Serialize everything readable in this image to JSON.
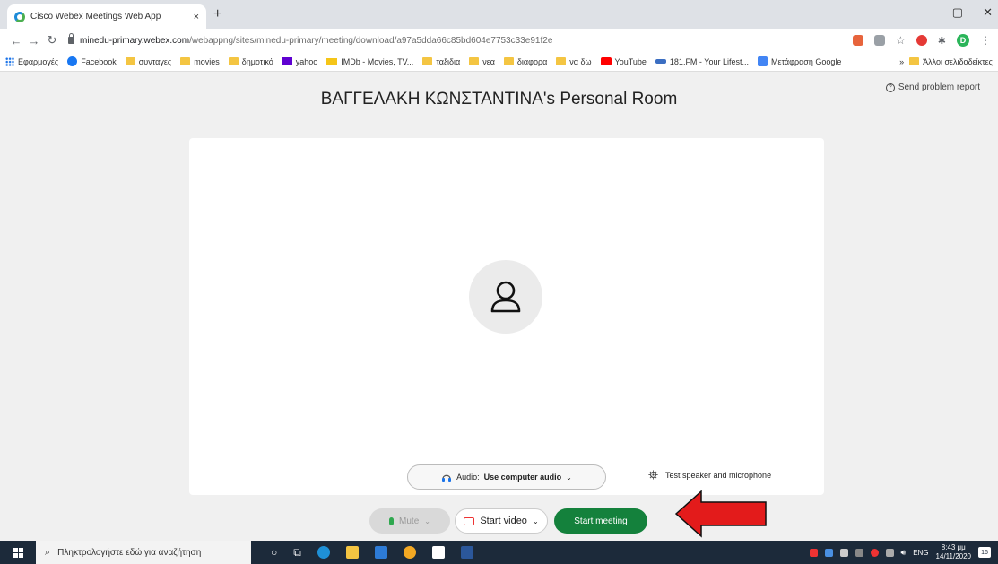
{
  "browser": {
    "tab_title": "Cisco Webex Meetings Web App",
    "tab_close": "×",
    "new_tab": "+",
    "url_host": "minedu-primary.webex.com",
    "url_path": "/webappng/sites/minedu-primary/meeting/download/a97a5dda66c85bd604e7753c33e91f2e",
    "profile_initial": "D",
    "window_controls": [
      "–",
      "▢",
      "✕"
    ]
  },
  "bookmarks": {
    "items": [
      "Εφαρμογές",
      "Facebook",
      "συνταγες",
      "movies",
      "δημοτικό",
      "yahoo",
      "IMDb - Movies, TV...",
      "ταξιδια",
      "νεα",
      "διαφορα",
      "να δω",
      "YouTube",
      "181.FM - Your Lifest...",
      "Μετάφραση Google"
    ],
    "overflow": "»",
    "other_bookmarks": "Άλλοι σελιδοδείκτες"
  },
  "page": {
    "room_title": "ΒΑΓΓΕΛΑΚΗ ΚΩΝΣΤΑΝΤΙΝΑ's Personal Room",
    "report_link": "Send problem report",
    "audio_prefix": "Audio:",
    "audio_value": "Use computer audio",
    "test_speaker": "Test speaker and microphone"
  },
  "controls": {
    "mute": "Mute",
    "start_video": "Start video",
    "start_meeting": "Start meeting",
    "chevron": "⌄"
  },
  "taskbar": {
    "search_placeholder": "Πληκτρολογήστε εδώ για αναζήτηση",
    "language": "ENG",
    "time": "8:43 μμ",
    "date": "14/11/2020",
    "notifications": "16"
  },
  "colors": {
    "start_meeting": "#14813c",
    "arrow": "#e31b1b",
    "taskbar": "#1c2a3a"
  }
}
